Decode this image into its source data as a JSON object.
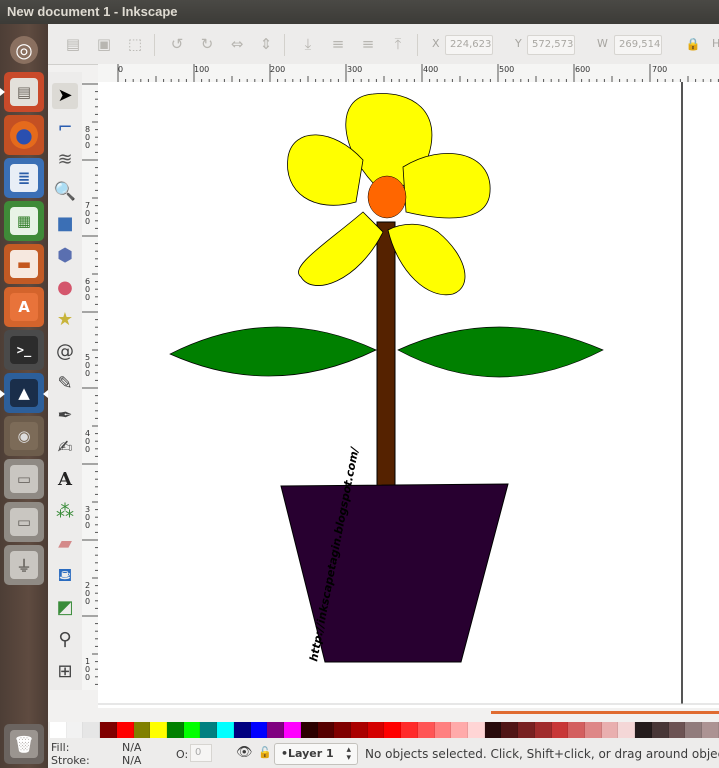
{
  "window": {
    "title": "New document 1 - Inkscape"
  },
  "launcher": {
    "items": [
      {
        "name": "ubuntu-dash-icon",
        "glyph": "◎"
      },
      {
        "name": "files-icon",
        "glyph": "▤"
      },
      {
        "name": "firefox-icon",
        "glyph": "●"
      },
      {
        "name": "writer-icon",
        "glyph": "≣"
      },
      {
        "name": "calc-icon",
        "glyph": "▦"
      },
      {
        "name": "impress-icon",
        "glyph": "▬"
      },
      {
        "name": "software-center-icon",
        "glyph": "A"
      },
      {
        "name": "terminal-icon",
        "glyph": ">_"
      },
      {
        "name": "inkscape-icon",
        "glyph": "▲"
      },
      {
        "name": "gimp-icon",
        "glyph": "◉"
      },
      {
        "name": "drive-icon-1",
        "glyph": "▭"
      },
      {
        "name": "drive-icon-2",
        "glyph": "▭"
      },
      {
        "name": "usb-drive-icon",
        "glyph": "⏚"
      },
      {
        "name": "trash-icon",
        "glyph": "🗑"
      }
    ]
  },
  "controls": {
    "x_label": "X",
    "x_value": "224,623",
    "y_label": "Y",
    "y_value": "572,573",
    "w_label": "W",
    "w_value": "269,514",
    "h_label": "H"
  },
  "ruler": {
    "h_ticks": [
      "0",
      "100",
      "200",
      "300",
      "400",
      "500",
      "600",
      "700"
    ],
    "v_ticks": [
      "8\n0\n0",
      "7\n0\n0",
      "6\n0\n0",
      "5\n0\n0",
      "4\n0\n0",
      "3\n0\n0",
      "2\n0\n0",
      "1\n0\n0"
    ]
  },
  "canvas": {
    "watermark": "http://inkscapetagin.blogspot.com/"
  },
  "colors": {
    "petal": "#ffff00",
    "center": "#ff6600",
    "stem": "#552200",
    "leaf": "#008000",
    "pot": "#280030"
  },
  "palette": [
    "#ffffff",
    "#f2f2f2",
    "#e6e6e6",
    "#800000",
    "#ff0000",
    "#808000",
    "#ffff00",
    "#008000",
    "#00ff00",
    "#008080",
    "#00ffff",
    "#000080",
    "#0000ff",
    "#800080",
    "#ff00ff",
    "#2b0000",
    "#550000",
    "#800000",
    "#aa0000",
    "#d40000",
    "#ff0000",
    "#ff2a2a",
    "#ff5555",
    "#ff8080",
    "#ffaaaa",
    "#ffd5d5",
    "#280b0b",
    "#501616",
    "#782121",
    "#a02c2c",
    "#c83737",
    "#d35f5f",
    "#de8787",
    "#e9afaf",
    "#f4d7d7",
    "#241c1c",
    "#483737",
    "#6c5353",
    "#917c7c",
    "#ac9393"
  ],
  "status": {
    "fill_label": "Fill:",
    "fill_value": "N/A",
    "stroke_label": "Stroke:",
    "stroke_value": "N/A",
    "opacity_label": "O:",
    "opacity_value": "0",
    "layer": "•Layer 1",
    "message": "No objects selected. Click, Shift+click, or drag around objects"
  }
}
